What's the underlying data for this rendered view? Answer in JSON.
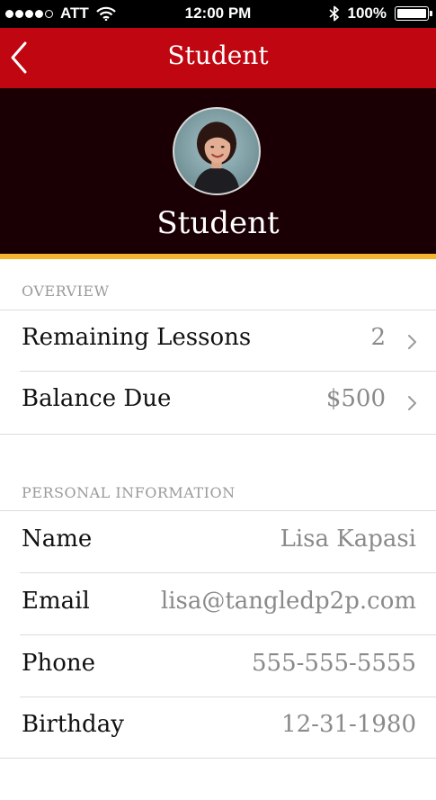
{
  "status_bar": {
    "carrier": "ATT",
    "time": "12:00 PM",
    "battery": "100%"
  },
  "nav": {
    "title": "Student",
    "back_icon": "chevron-left-icon"
  },
  "profile": {
    "name": "Student"
  },
  "overview": {
    "header": "OVERVIEW",
    "rows": [
      {
        "label": "Remaining Lessons",
        "value": "2"
      },
      {
        "label": "Balance Due",
        "value": "$500"
      }
    ]
  },
  "personal": {
    "header": "PERSONAL INFORMATION",
    "rows": [
      {
        "label": "Name",
        "value": "Lisa Kapasi"
      },
      {
        "label": "Email",
        "value": "lisa@tangledp2p.com"
      },
      {
        "label": "Phone",
        "value": "555-555-5555"
      },
      {
        "label": "Birthday",
        "value": "12-31-1980"
      }
    ]
  },
  "colors": {
    "nav_red": "#c00610",
    "profile_bg": "#1a0004",
    "accent_gold": "#f5b52e",
    "muted_text": "#8a8a8a"
  }
}
